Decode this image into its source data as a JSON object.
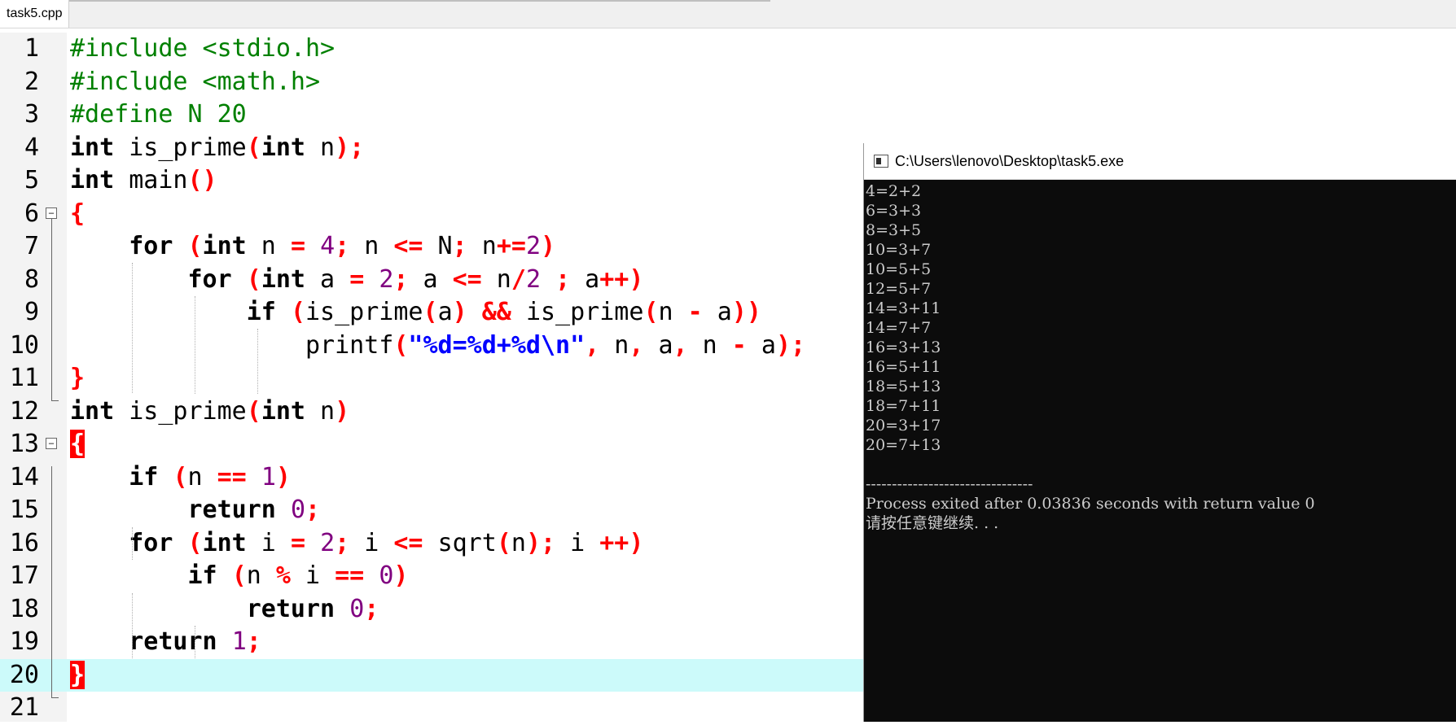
{
  "editor": {
    "tab_label": "task5.cpp",
    "lines": [
      {
        "no": "1"
      },
      {
        "no": "2"
      },
      {
        "no": "3"
      },
      {
        "no": "4"
      },
      {
        "no": "5"
      },
      {
        "no": "6"
      },
      {
        "no": "7"
      },
      {
        "no": "8"
      },
      {
        "no": "9"
      },
      {
        "no": "10"
      },
      {
        "no": "11"
      },
      {
        "no": "12"
      },
      {
        "no": "13"
      },
      {
        "no": "14"
      },
      {
        "no": "15"
      },
      {
        "no": "16"
      },
      {
        "no": "17"
      },
      {
        "no": "18"
      },
      {
        "no": "19"
      },
      {
        "no": "20"
      },
      {
        "no": "21"
      }
    ],
    "code": {
      "l1": "#include <stdio.h>",
      "l2": "#include <math.h>",
      "l3": "#define N 20",
      "int": "int",
      "for": "for",
      "if": "if",
      "return": "return",
      "is_prime": "is_prime",
      "main": "main",
      "printf": "printf",
      "sqrt": "sqrt",
      "fmt": "\"%d=%d+%d\\n\""
    }
  },
  "console": {
    "title": "C:\\Users\\lenovo\\Desktop\\task5.exe",
    "output": [
      "4=2+2",
      "6=3+3",
      "8=3+5",
      "10=3+7",
      "10=5+5",
      "12=5+7",
      "14=3+11",
      "14=7+7",
      "16=3+13",
      "16=5+11",
      "18=5+13",
      "18=7+11",
      "20=3+17",
      "20=7+13"
    ],
    "separator": "--------------------------------",
    "exit_message": "Process exited after 0.03836 seconds with return value 0",
    "prompt": "请按任意键继续. . ."
  },
  "colors": {
    "keyword": "#000000",
    "preprocessor": "#008000",
    "number": "#800080",
    "operator": "#ff0000",
    "string": "#0000ff",
    "current_line": "#ccfafa"
  }
}
